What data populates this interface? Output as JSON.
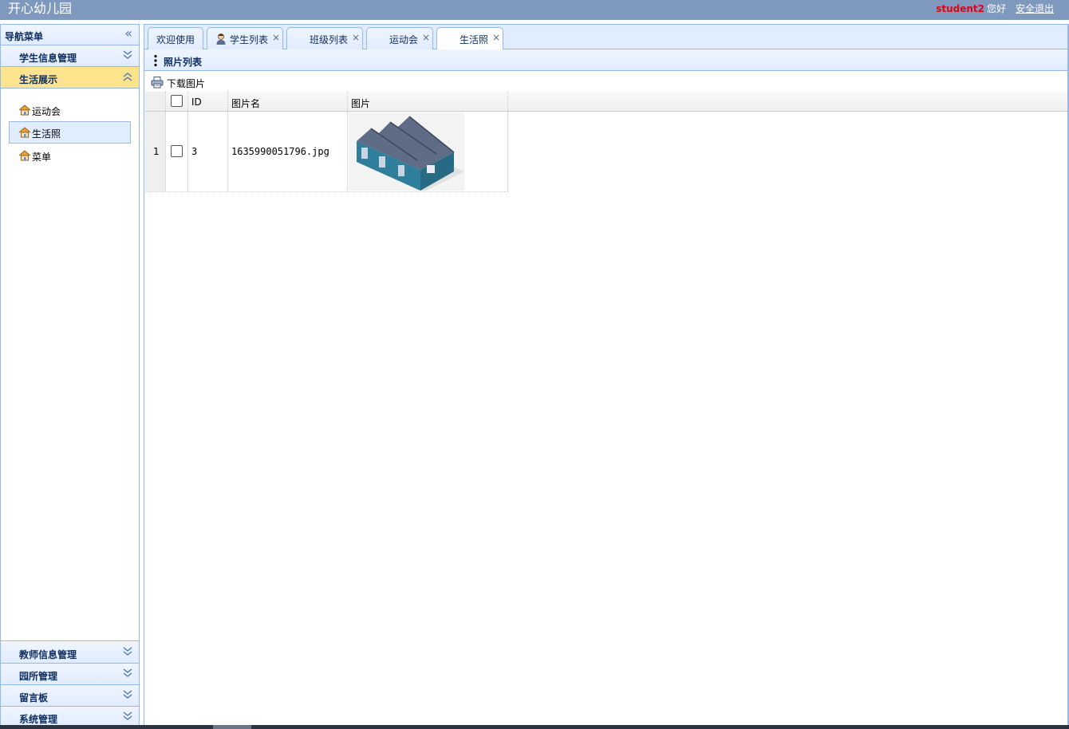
{
  "header": {
    "app_title": "开心幼儿园",
    "username": "student2",
    "greeting": "您好",
    "logout_label": "安全退出"
  },
  "sidebar": {
    "title": "导航菜单",
    "sections": [
      {
        "label": "学生信息管理",
        "expanded": false
      },
      {
        "label": "生活展示",
        "expanded": true,
        "items": [
          {
            "label": "运动会",
            "icon": "house-icon",
            "selected": false
          },
          {
            "label": "生活照",
            "icon": "house-icon",
            "selected": true
          },
          {
            "label": "菜单",
            "icon": "house-icon",
            "selected": false
          }
        ]
      },
      {
        "label": "教师信息管理",
        "expanded": false
      },
      {
        "label": "园所管理",
        "expanded": false
      },
      {
        "label": "留言板",
        "expanded": false
      },
      {
        "label": "系统管理",
        "expanded": false
      }
    ]
  },
  "tabs": [
    {
      "label": "欢迎使用",
      "closable": false,
      "icon": null
    },
    {
      "label": "学生列表",
      "closable": true,
      "icon": "student-icon"
    },
    {
      "label": "班级列表",
      "closable": true,
      "icon": null
    },
    {
      "label": "运动会",
      "closable": true,
      "icon": null
    },
    {
      "label": "生活照",
      "closable": true,
      "active": true,
      "icon": null
    }
  ],
  "close_glyph": "×",
  "panel": {
    "title": "照片列表",
    "toolbar": {
      "download_label": "下载图片",
      "icon": "printer-icon"
    }
  },
  "grid": {
    "columns": [
      "ID",
      "图片名",
      "图片"
    ],
    "rows": [
      {
        "row_number": "1",
        "id": "3",
        "filename": "1635990051796.jpg",
        "image": "factory-building-image"
      }
    ]
  },
  "colors": {
    "header_bg": "#7f99be",
    "username": "#e60012",
    "active_section_bg": "#ffe48d",
    "panel_border": "#95b8e7"
  }
}
